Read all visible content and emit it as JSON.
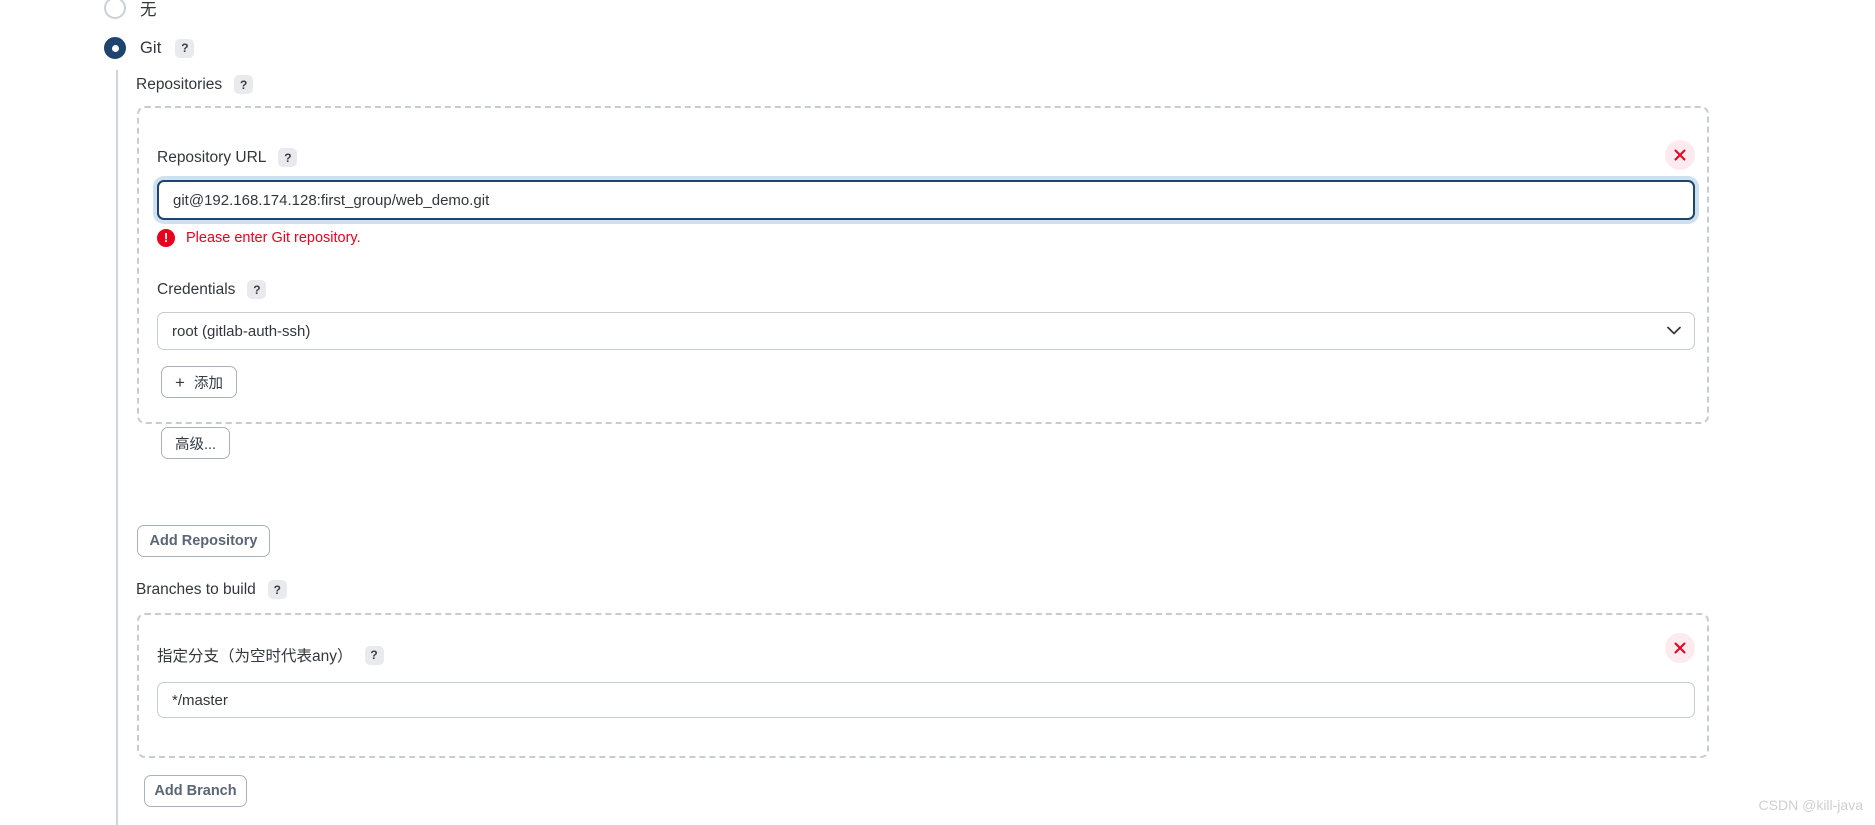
{
  "scm": {
    "options": [
      {
        "label": "无",
        "selected": false,
        "has_help": false
      },
      {
        "label": "Git",
        "selected": true,
        "has_help": true
      }
    ]
  },
  "repositories": {
    "label": "Repositories",
    "help": "?",
    "repository_url": {
      "label": "Repository URL",
      "help": "?",
      "value": "git@192.168.174.128:first_group/web_demo.git",
      "focused": true,
      "error": "Please enter Git repository.",
      "error_icon": "error-circle-icon"
    },
    "credentials": {
      "label": "Credentials",
      "help": "?",
      "selected": "root (gitlab-auth-ssh)",
      "chevron": "chevron-down-icon",
      "add_button": {
        "icon": "plus-icon",
        "label": "添加"
      },
      "advanced_button": "高级..."
    },
    "delete_icon": "close-icon",
    "add_repository_button": "Add Repository"
  },
  "branches": {
    "label": "Branches to build",
    "help": "?",
    "branch_spec": {
      "label": "指定分支（为空时代表any）",
      "help": "?",
      "value": "*/master"
    },
    "delete_icon": "close-icon",
    "add_branch_button": "Add Branch"
  },
  "watermark": "CSDN @kill-java",
  "colors": {
    "accent": "#1f456e",
    "error": "#e8001f",
    "error_bg": "#fdeaee",
    "dashed_border": "#c7ccd1",
    "focus_ring": "#cfe0ee"
  }
}
